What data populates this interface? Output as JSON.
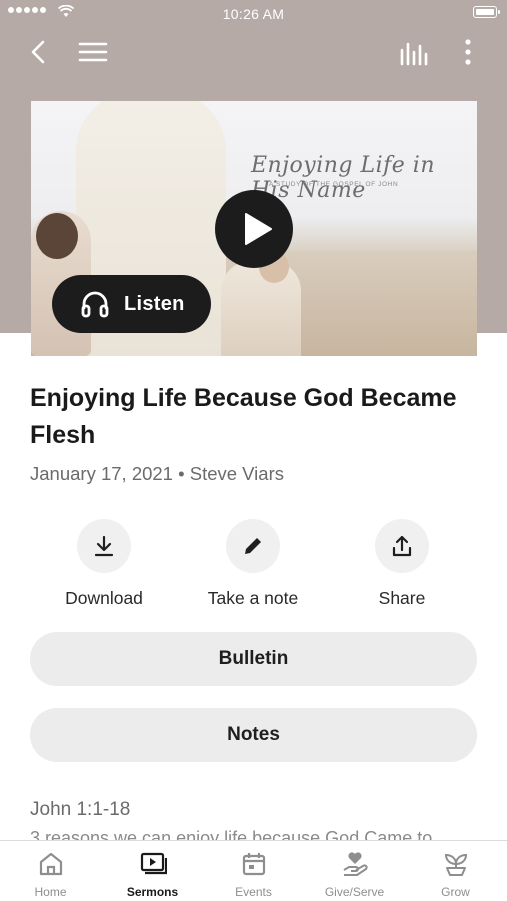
{
  "status_bar": {
    "time": "10:26 AM"
  },
  "artwork": {
    "title": "Enjoying Life in His Name",
    "subtitle": "A STUDY OF THE GOSPEL OF JOHN"
  },
  "player": {
    "listen_label": "Listen"
  },
  "sermon": {
    "title": "Enjoying Life Because God Became Flesh",
    "meta": "January 17, 2021 • Steve Viars",
    "scripture": "John 1:1-18",
    "summary": "3 reasons we can enjoy life because God Came to"
  },
  "actions": {
    "download": "Download",
    "note": "Take a note",
    "share": "Share"
  },
  "buttons": {
    "bulletin": "Bulletin",
    "notes": "Notes"
  },
  "tabs": [
    {
      "label": "Home",
      "icon": "home-icon"
    },
    {
      "label": "Sermons",
      "icon": "sermons-icon",
      "active": true
    },
    {
      "label": "Events",
      "icon": "calendar-icon"
    },
    {
      "label": "Give/Serve",
      "icon": "give-icon"
    },
    {
      "label": "Grow",
      "icon": "sprout-icon"
    }
  ],
  "colors": {
    "hero_background": "#b5aaa5",
    "button_dark": "#1c1c1c",
    "pill_background": "#ececec"
  }
}
